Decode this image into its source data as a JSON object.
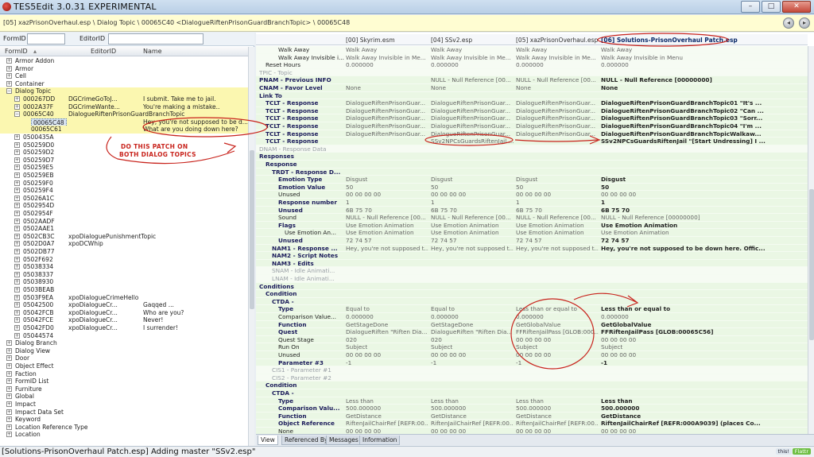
{
  "window": {
    "title": "TES5Edit 3.0.31 EXPERIMENTAL",
    "minimize": "–",
    "maximize": "□",
    "close": "✕"
  },
  "pathbar": {
    "path": "[05] xazPrisonOverhaul.esp \\ Dialog Topic \\ 00065C40 <DialogueRiftenPrisonGuardBranchTopic> \\ 00065C48",
    "back_icon": "back-arrow-icon",
    "forward_icon": "forward-arrow-icon"
  },
  "filters": {
    "formid_label": "FormID",
    "editorid_label": "EditorID"
  },
  "tree": {
    "headers": {
      "formid": "FormID",
      "editorid": "EditorID",
      "name": "Name"
    },
    "rows": [
      {
        "exp": "+",
        "indent": 1,
        "id": "Armor Addon",
        "edid": "",
        "name": ""
      },
      {
        "exp": "+",
        "indent": 1,
        "id": "Armor",
        "edid": "",
        "name": ""
      },
      {
        "exp": "+",
        "indent": 1,
        "id": "Cell",
        "edid": "",
        "name": ""
      },
      {
        "exp": "+",
        "indent": 1,
        "id": "Container",
        "edid": "",
        "name": ""
      },
      {
        "exp": "−",
        "indent": 1,
        "id": "Dialog Topic",
        "edid": "",
        "name": "",
        "hl": true
      },
      {
        "exp": "+",
        "indent": 2,
        "id": "000267DD",
        "edid": "DGCrimeGoToJ...",
        "name": "I submit. Take me to jail.",
        "hl": true
      },
      {
        "exp": "+",
        "indent": 2,
        "id": "0002A37F",
        "edid": "DGCrimeWante...",
        "name": "You're making a mistake..",
        "hl": true
      },
      {
        "exp": "−",
        "indent": 2,
        "id": "00065C40",
        "edid": "DialogueRiftenPrisonGuardBranchTopic",
        "name": "",
        "hl": true
      },
      {
        "exp": "",
        "indent": 3,
        "id": "00065C48",
        "edid": "",
        "name": "Hey, you're not supposed to be d...",
        "hl": true,
        "sel": true
      },
      {
        "exp": "",
        "indent": 3,
        "id": "00065C61",
        "edid": "",
        "name": "What are you doing down here?",
        "hl": true
      },
      {
        "exp": "+",
        "indent": 2,
        "id": "0500435A",
        "edid": "",
        "name": ""
      },
      {
        "exp": "+",
        "indent": 2,
        "id": "050259D0",
        "edid": "",
        "name": ""
      },
      {
        "exp": "+",
        "indent": 2,
        "id": "050259D2",
        "edid": "",
        "name": ""
      },
      {
        "exp": "+",
        "indent": 2,
        "id": "050259D7",
        "edid": "",
        "name": ""
      },
      {
        "exp": "+",
        "indent": 2,
        "id": "050259E5",
        "edid": "",
        "name": ""
      },
      {
        "exp": "+",
        "indent": 2,
        "id": "050259EB",
        "edid": "",
        "name": ""
      },
      {
        "exp": "+",
        "indent": 2,
        "id": "050259F0",
        "edid": "",
        "name": ""
      },
      {
        "exp": "+",
        "indent": 2,
        "id": "050259F4",
        "edid": "",
        "name": ""
      },
      {
        "exp": "+",
        "indent": 2,
        "id": "05026A1C",
        "edid": "",
        "name": ""
      },
      {
        "exp": "+",
        "indent": 2,
        "id": "0502954D",
        "edid": "",
        "name": ""
      },
      {
        "exp": "+",
        "indent": 2,
        "id": "0502954F",
        "edid": "",
        "name": ""
      },
      {
        "exp": "+",
        "indent": 2,
        "id": "0502AADF",
        "edid": "",
        "name": ""
      },
      {
        "exp": "+",
        "indent": 2,
        "id": "0502AAE1",
        "edid": "",
        "name": ""
      },
      {
        "exp": "+",
        "indent": 2,
        "id": "0502CB3C",
        "edid": "xpoDialoguePunishmentTopic",
        "name": ""
      },
      {
        "exp": "+",
        "indent": 2,
        "id": "0502D0A7",
        "edid": "xpoDCWhip",
        "name": ""
      },
      {
        "exp": "+",
        "indent": 2,
        "id": "0502DB77",
        "edid": "",
        "name": ""
      },
      {
        "exp": "+",
        "indent": 2,
        "id": "0502F692",
        "edid": "",
        "name": ""
      },
      {
        "exp": "+",
        "indent": 2,
        "id": "05038334",
        "edid": "",
        "name": ""
      },
      {
        "exp": "+",
        "indent": 2,
        "id": "05038337",
        "edid": "",
        "name": ""
      },
      {
        "exp": "+",
        "indent": 2,
        "id": "05038930",
        "edid": "",
        "name": ""
      },
      {
        "exp": "+",
        "indent": 2,
        "id": "0503BEAB",
        "edid": "",
        "name": ""
      },
      {
        "exp": "+",
        "indent": 2,
        "id": "0503F9EA",
        "edid": "xpoDialogueCrimeHello",
        "name": ""
      },
      {
        "exp": "+",
        "indent": 2,
        "id": "05042500",
        "edid": "xpoDialogueCr...",
        "name": "Gaqqed ..."
      },
      {
        "exp": "+",
        "indent": 2,
        "id": "05042FCB",
        "edid": "xpoDialogueCr...",
        "name": "Who are you?"
      },
      {
        "exp": "+",
        "indent": 2,
        "id": "05042FCE",
        "edid": "xpoDialogueCr...",
        "name": "Never!"
      },
      {
        "exp": "+",
        "indent": 2,
        "id": "05042FD0",
        "edid": "xpoDialogueCr...",
        "name": "I surrender!"
      },
      {
        "exp": "+",
        "indent": 2,
        "id": "05044574",
        "edid": "",
        "name": ""
      },
      {
        "exp": "+",
        "indent": 1,
        "id": "Dialog Branch",
        "edid": "",
        "name": ""
      },
      {
        "exp": "+",
        "indent": 1,
        "id": "Dialog View",
        "edid": "",
        "name": ""
      },
      {
        "exp": "+",
        "indent": 1,
        "id": "Door",
        "edid": "",
        "name": ""
      },
      {
        "exp": "+",
        "indent": 1,
        "id": "Object Effect",
        "edid": "",
        "name": ""
      },
      {
        "exp": "+",
        "indent": 1,
        "id": "Faction",
        "edid": "",
        "name": ""
      },
      {
        "exp": "+",
        "indent": 1,
        "id": "FormID List",
        "edid": "",
        "name": ""
      },
      {
        "exp": "+",
        "indent": 1,
        "id": "Furniture",
        "edid": "",
        "name": ""
      },
      {
        "exp": "+",
        "indent": 1,
        "id": "Global",
        "edid": "",
        "name": ""
      },
      {
        "exp": "+",
        "indent": 1,
        "id": "Impact",
        "edid": "",
        "name": ""
      },
      {
        "exp": "+",
        "indent": 1,
        "id": "Impact Data Set",
        "edid": "",
        "name": ""
      },
      {
        "exp": "+",
        "indent": 1,
        "id": "Keyword",
        "edid": "",
        "name": ""
      },
      {
        "exp": "+",
        "indent": 1,
        "id": "Location Reference Type",
        "edid": "",
        "name": ""
      },
      {
        "exp": "+",
        "indent": 1,
        "id": "Location",
        "edid": "",
        "name": ""
      }
    ]
  },
  "grid": {
    "headers": [
      "[00] Skyrim.esm",
      "[04] SSv2.esp",
      "[05] xazPrisonOverhaul.esp",
      "[06] Solutions-PrisonOverhaul Patch.esp"
    ],
    "rows": [
      {
        "i": 3,
        "l": "Walk Away",
        "s": "",
        "v": [
          "Walk Away",
          "Walk Away",
          "Walk Away",
          "Walk Away"
        ],
        "w": 1
      },
      {
        "i": 3,
        "l": "Walk Away Invisible i...",
        "s": "",
        "v": [
          "Walk Away Invisible in Me...",
          "Walk Away Invisible in Me...",
          "Walk Away Invisible in Me...",
          "Walk Away Invisible in Menu"
        ],
        "w": 1
      },
      {
        "i": 1,
        "l": "Reset Hours",
        "s": "",
        "v": [
          "0.000000",
          "0.000000",
          "0.000000",
          "0.000000"
        ],
        "w": 1
      },
      {
        "i": 0,
        "l": "TPIC - Topic",
        "s": "g",
        "v": [
          "",
          "",
          "",
          ""
        ],
        "w": 1
      },
      {
        "i": 0,
        "l": "PNAM - Previous INFO",
        "s": "b",
        "v": [
          "",
          "NULL - Null Reference [00...",
          "NULL - Null Reference [00...",
          "NULL - Null Reference [00000000]"
        ]
      },
      {
        "i": 0,
        "l": "CNAM - Favor Level",
        "s": "b",
        "v": [
          "None",
          "None",
          "None",
          "None"
        ]
      },
      {
        "i": 0,
        "l": "Link To",
        "s": "b",
        "v": [
          "",
          "",
          "",
          ""
        ]
      },
      {
        "i": 1,
        "l": "TCLT - Response",
        "s": "b",
        "v": [
          "DialogueRiftenPrisonGuar...",
          "DialogueRiftenPrisonGuar...",
          "DialogueRiftenPrisonGuar...",
          "DialogueRiftenPrisonGuardBranchTopic01 \"It's ..."
        ]
      },
      {
        "i": 1,
        "l": "TCLT - Response",
        "s": "b",
        "v": [
          "DialogueRiftenPrisonGuar...",
          "DialogueRiftenPrisonGuar...",
          "DialogueRiftenPrisonGuar...",
          "DialogueRiftenPrisonGuardBranchTopic02 \"Can ..."
        ]
      },
      {
        "i": 1,
        "l": "TCLT - Response",
        "s": "b",
        "v": [
          "DialogueRiftenPrisonGuar...",
          "DialogueRiftenPrisonGuar...",
          "DialogueRiftenPrisonGuar...",
          "DialogueRiftenPrisonGuardBranchTopic03 \"Sorr..."
        ]
      },
      {
        "i": 1,
        "l": "TCLT - Response",
        "s": "b",
        "v": [
          "DialogueRiftenPrisonGuar...",
          "DialogueRiftenPrisonGuar...",
          "DialogueRiftenPrisonGuar...",
          "DialogueRiftenPrisonGuardBranchTopic04 \"I'm ..."
        ]
      },
      {
        "i": 1,
        "l": "TCLT - Response",
        "s": "b",
        "v": [
          "DialogueRiftenPrisonGuar...",
          "DialogueRiftenPrisonGuar...",
          "DialogueRiftenPrisonGuar...",
          "DialogueRiftenPrisonGuardBranchTopicWalkaw..."
        ]
      },
      {
        "i": 1,
        "l": "TCLT - Response",
        "s": "b",
        "v": [
          "",
          "SSv2NPCsGuardsRiftenJail ...",
          "",
          "SSv2NPCsGuardsRiftenJail \"[Start Undressing] I ..."
        ]
      },
      {
        "i": 0,
        "l": "DNAM - Response Data",
        "s": "g",
        "v": [
          "",
          "",
          "",
          ""
        ],
        "w": 1
      },
      {
        "i": 0,
        "l": "Responses",
        "s": "b",
        "v": [
          "",
          "",
          "",
          ""
        ]
      },
      {
        "i": 1,
        "l": "Response",
        "s": "b",
        "v": [
          "",
          "",
          "",
          ""
        ]
      },
      {
        "i": 2,
        "l": "TRDT - Response D...",
        "s": "b",
        "v": [
          "",
          "",
          "",
          ""
        ]
      },
      {
        "i": 3,
        "l": "Emotion Type",
        "s": "b",
        "v": [
          "Disgust",
          "Disgust",
          "Disgust",
          "Disgust"
        ]
      },
      {
        "i": 3,
        "l": "Emotion Value",
        "s": "b",
        "v": [
          "50",
          "50",
          "50",
          "50"
        ]
      },
      {
        "i": 3,
        "l": "Unused",
        "s": "",
        "v": [
          "00 00 00 00",
          "00 00 00 00",
          "00 00 00 00",
          "00 00 00 00"
        ]
      },
      {
        "i": 3,
        "l": "Response number",
        "s": "b",
        "v": [
          "1",
          "1",
          "1",
          "1"
        ]
      },
      {
        "i": 3,
        "l": "Unused",
        "s": "b",
        "v": [
          "6B 75 70",
          "6B 75 70",
          "6B 75 70",
          "6B 75 70"
        ]
      },
      {
        "i": 3,
        "l": "Sound",
        "s": "",
        "v": [
          "NULL - Null Reference [00...",
          "NULL - Null Reference [00...",
          "NULL - Null Reference [00...",
          "NULL - Null Reference [00000000]"
        ]
      },
      {
        "i": 3,
        "l": "Flags",
        "s": "b",
        "v": [
          "Use Emotion Animation",
          "Use Emotion Animation",
          "Use Emotion Animation",
          "Use Emotion Animation"
        ]
      },
      {
        "i": 4,
        "l": "Use Emotion An...",
        "s": "",
        "v": [
          "Use Emotion Animation",
          "Use Emotion Animation",
          "Use Emotion Animation",
          "Use Emotion Animation"
        ]
      },
      {
        "i": 3,
        "l": "Unused",
        "s": "b",
        "v": [
          "72 74 57",
          "72 74 57",
          "72 74 57",
          "72 74 57"
        ]
      },
      {
        "i": 2,
        "l": "NAM1 - Response ...",
        "s": "b",
        "v": [
          "Hey, you're not supposed t...",
          "Hey, you're not supposed t...",
          "Hey, you're not supposed t...",
          "Hey, you're not supposed to be down here. Offic..."
        ]
      },
      {
        "i": 2,
        "l": "NAM2 - Script Notes",
        "s": "b",
        "v": [
          "",
          "",
          "",
          ""
        ]
      },
      {
        "i": 2,
        "l": "NAM3 - Edits",
        "s": "b",
        "v": [
          "",
          "",
          "",
          ""
        ]
      },
      {
        "i": 2,
        "l": "SNAM - Idle Animati...",
        "s": "g",
        "v": [
          "",
          "",
          "",
          ""
        ],
        "w": 1
      },
      {
        "i": 2,
        "l": "LNAM - Idle Animati...",
        "s": "g",
        "v": [
          "",
          "",
          "",
          ""
        ],
        "w": 1
      },
      {
        "i": 0,
        "l": "Conditions",
        "s": "b",
        "v": [
          "",
          "",
          "",
          ""
        ]
      },
      {
        "i": 1,
        "l": "Condition",
        "s": "b",
        "v": [
          "",
          "",
          "",
          ""
        ]
      },
      {
        "i": 2,
        "l": "CTDA -",
        "s": "b",
        "v": [
          "",
          "",
          "",
          ""
        ]
      },
      {
        "i": 3,
        "l": "Type",
        "s": "b",
        "v": [
          "Equal to",
          "Equal to",
          "Less than or equal to",
          "Less than or equal to"
        ]
      },
      {
        "i": 3,
        "l": "Comparison Value...",
        "s": "",
        "v": [
          "0.000000",
          "0.000000",
          "0.000000",
          "0.000000"
        ]
      },
      {
        "i": 3,
        "l": "Function",
        "s": "b",
        "v": [
          "GetStageDone",
          "GetStageDone",
          "GetGlobalValue",
          "GetGlobalValue"
        ]
      },
      {
        "i": 3,
        "l": "Quest",
        "s": "b",
        "v": [
          "DialogueRiften \"Riften Dia...",
          "DialogueRiften \"Riften Dia...",
          "FFRiftenJailPass [GLOB:000...",
          "FFRiftenJailPass [GLOB:00065C56]"
        ]
      },
      {
        "i": 3,
        "l": "Quest Stage",
        "s": "",
        "v": [
          "020",
          "020",
          "00 00 00 00",
          "00 00 00 00"
        ]
      },
      {
        "i": 3,
        "l": "Run On",
        "s": "",
        "v": [
          "Subject",
          "Subject",
          "Subject",
          "Subject"
        ]
      },
      {
        "i": 3,
        "l": "Unused",
        "s": "",
        "v": [
          "00 00 00 00",
          "00 00 00 00",
          "00 00 00 00",
          "00 00 00 00"
        ]
      },
      {
        "i": 3,
        "l": "Parameter #3",
        "s": "b",
        "v": [
          "-1",
          "-1",
          "-1",
          "-1"
        ]
      },
      {
        "i": 2,
        "l": "CIS1 - Parameter #1",
        "s": "g",
        "v": [
          "",
          "",
          "",
          ""
        ],
        "w": 1
      },
      {
        "i": 2,
        "l": "CIS2 - Parameter #2",
        "s": "g",
        "v": [
          "",
          "",
          "",
          ""
        ],
        "w": 1
      },
      {
        "i": 1,
        "l": "Condition",
        "s": "b",
        "v": [
          "",
          "",
          "",
          ""
        ]
      },
      {
        "i": 2,
        "l": "CTDA -",
        "s": "b",
        "v": [
          "",
          "",
          "",
          ""
        ]
      },
      {
        "i": 3,
        "l": "Type",
        "s": "b",
        "v": [
          "Less than",
          "Less than",
          "Less than",
          "Less than"
        ]
      },
      {
        "i": 3,
        "l": "Comparison Valu...",
        "s": "b",
        "v": [
          "500.000000",
          "500.000000",
          "500.000000",
          "500.000000"
        ]
      },
      {
        "i": 3,
        "l": "Function",
        "s": "b",
        "v": [
          "GetDistance",
          "GetDistance",
          "GetDistance",
          "GetDistance"
        ]
      },
      {
        "i": 3,
        "l": "Object Reference",
        "s": "b",
        "v": [
          "RiftenJailChairRef [REFR:00...",
          "RiftenJailChairRef [REFR:00...",
          "RiftenJailChairRef [REFR:00...",
          "RiftenJailChairRef [REFR:000A9039] (places Co..."
        ]
      },
      {
        "i": 3,
        "l": "None",
        "s": "",
        "v": [
          "00 00 00 00",
          "00 00 00 00",
          "00 00 00 00",
          "00 00 00 00"
        ]
      }
    ]
  },
  "tabs": [
    "View",
    "Referenced By",
    "Messages",
    "Information"
  ],
  "status": "[Solutions-PrisonOverhaul Patch.esp] Adding master \"SSv2.esp\"",
  "flattr": {
    "flattr": "Flattr",
    "this": "this!"
  },
  "annotation": {
    "line1": "DO THIS PATCH ON",
    "line2": "BOTH DIALOG TOPICS"
  },
  "colors": {
    "annotation_red": "#c8231c",
    "modified_row": "#eaf7e4",
    "highlight": "#fbf7b0"
  }
}
